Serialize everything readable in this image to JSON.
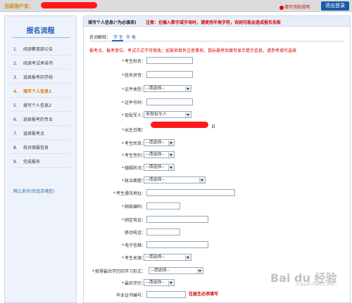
{
  "topbar": {
    "user_label": "当前用户名：",
    "notice_link": "填写须知说明",
    "logout": "退出登录"
  },
  "sidebar": {
    "title": "报名流程",
    "steps": [
      {
        "num": "1.",
        "label": "阅读教育部公告"
      },
      {
        "num": "2.",
        "label": "阅读考试承诺书"
      },
      {
        "num": "3.",
        "label": "选择报考的学校"
      },
      {
        "num": "4.",
        "label": "填写个人信息1"
      },
      {
        "num": "5.",
        "label": "填写个人信息2"
      },
      {
        "num": "6.",
        "label": "选择报考的专业"
      },
      {
        "num": "7.",
        "label": "选择报考点"
      },
      {
        "num": "8.",
        "label": "校对填报信息"
      },
      {
        "num": "9.",
        "label": "完成报名"
      }
    ],
    "link": "网上支付(仅北京地区)"
  },
  "main": {
    "header_title": "填写个人信息(",
    "header_title_mark": "*",
    "header_title_tail": "为必填项)",
    "header_note": "注意：在输入数字或字母时，请使用半角字符，否则可能会造成报名失败",
    "tabs_label": "名词解释：",
    "tab1": "学  生",
    "tab2": "半 角",
    "red_note": "报考点、报考单位、考试方式不可修改；如某项目有注意事项，鼠标悬停页面可显示提示信息，请参考填写选择",
    "fields": {
      "name": "考生姓名：",
      "pinyin": "姓名拼音：",
      "id_type": "证件类型：",
      "id_number": "证件号码：",
      "soldier": "现役军人：",
      "birth": "出生日期：",
      "ethnicity": "考生民族：",
      "gender": "考生性别：",
      "marital": "婚姻状况：",
      "politics": "政治面貌：",
      "address": "考生通讯地址：",
      "postcode": "邮政编码：",
      "phone": "固定电话：",
      "mobile": "移动电话：",
      "email": "电子信箱：",
      "source": "考生来源：",
      "study_form": "取得最后学历的学习形式：",
      "degree": "最后学历：",
      "grad_cert": "毕业证书编号："
    },
    "select_placeholder": "--请选择--",
    "soldier_value": "非现役军人",
    "day_suffix": "日",
    "grad_note": "往届生必须填写"
  },
  "watermark": {
    "main": "Bai du 经验",
    "sub": "jingyan.baidu.com"
  }
}
